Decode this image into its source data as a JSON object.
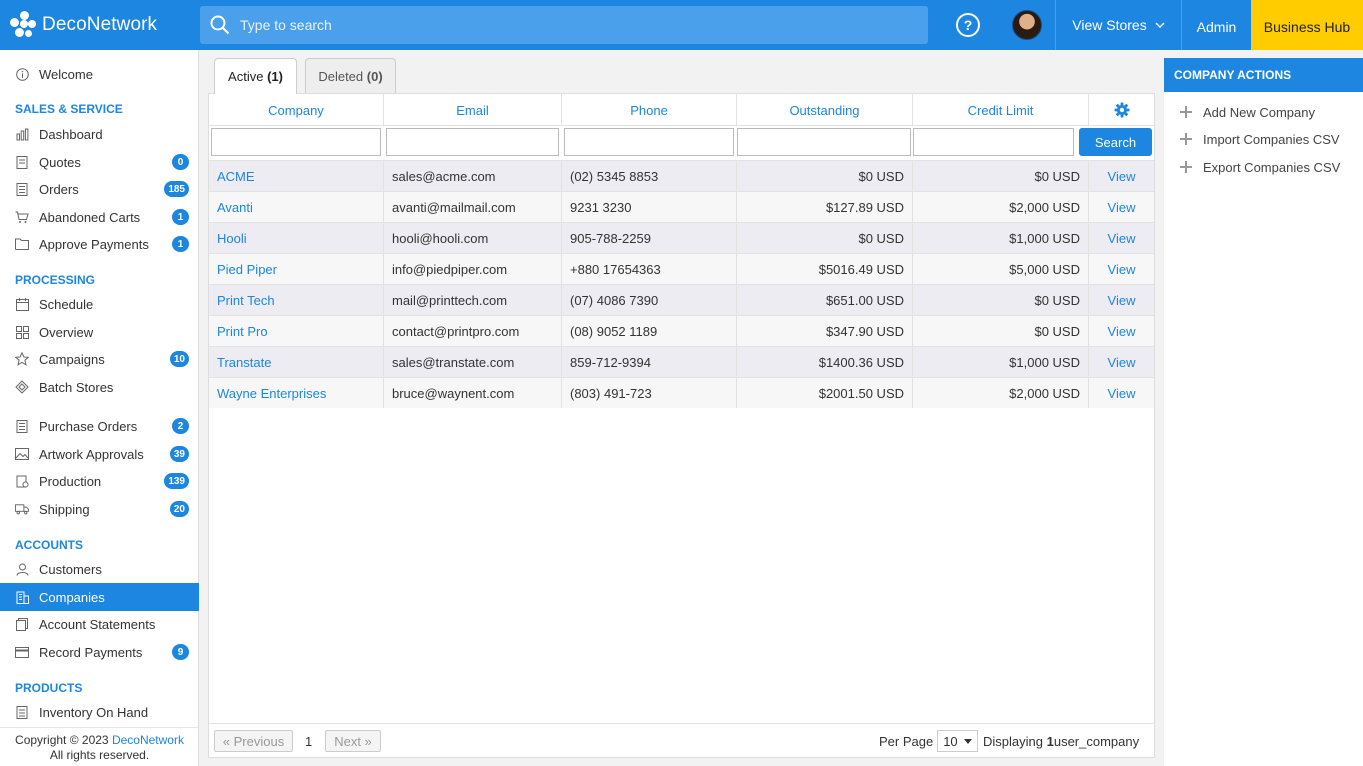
{
  "header": {
    "logo_text": "DecoNetwork",
    "search_placeholder": "Type to search",
    "help_label": "?",
    "view_stores_label": "View Stores",
    "admin_label": "Admin",
    "business_hub_label": "Business Hub"
  },
  "sidebar": {
    "welcome": "Welcome",
    "sections": {
      "sales": "SALES & SERVICE",
      "processing": "PROCESSING",
      "accounts": "ACCOUNTS",
      "products": "PRODUCTS"
    },
    "items": {
      "dashboard": "Dashboard",
      "quotes": "Quotes",
      "quotes_badge": "0",
      "orders": "Orders",
      "orders_badge": "185",
      "abandoned_carts": "Abandoned Carts",
      "abandoned_carts_badge": "1",
      "approve_payments": "Approve Payments",
      "approve_payments_badge": "1",
      "schedule": "Schedule",
      "overview": "Overview",
      "campaigns": "Campaigns",
      "campaigns_badge": "10",
      "batch_stores": "Batch Stores",
      "purchase_orders": "Purchase Orders",
      "purchase_orders_badge": "2",
      "artwork_approvals": "Artwork Approvals",
      "artwork_approvals_badge": "39",
      "production": "Production",
      "production_badge": "139",
      "shipping": "Shipping",
      "shipping_badge": "20",
      "customers": "Customers",
      "companies": "Companies",
      "account_statements": "Account Statements",
      "record_payments": "Record Payments",
      "record_payments_badge": "9",
      "inventory_on_hand": "Inventory On Hand"
    },
    "footer": {
      "copyright": "Copyright © 2023 ",
      "brand_link": "DecoNetwork",
      "rights": "All rights reserved."
    }
  },
  "tabs": {
    "active_label": "Active",
    "active_count": "(1)",
    "deleted_label": "Deleted",
    "deleted_count": "(0)"
  },
  "grid": {
    "columns": [
      "Company",
      "Email",
      "Phone",
      "Outstanding",
      "Credit Limit"
    ],
    "search_label": "Search",
    "view_label": "View",
    "rows": [
      [
        "ACME",
        "sales@acme.com",
        "(02) 5345 8853",
        "$0 USD",
        "$0 USD"
      ],
      [
        "Avanti",
        "avanti@mailmail.com",
        "9231 3230",
        "$127.89 USD",
        "$2,000 USD"
      ],
      [
        "Hooli",
        "hooli@hooli.com",
        "905-788-2259",
        "$0 USD",
        "$1,000 USD"
      ],
      [
        "Pied Piper",
        "info@piedpiper.com",
        "+880 17654363",
        "$5016.49 USD",
        "$5,000 USD"
      ],
      [
        "Print Tech",
        "mail@printtech.com",
        "(07) 4086 7390",
        "$651.00 USD",
        "$0 USD"
      ],
      [
        "Print Pro",
        "contact@printpro.com",
        "(08) 9052 1189",
        "$347.90 USD",
        "$0 USD"
      ],
      [
        "Transtate",
        "sales@transtate.com",
        "859-712-9394",
        "$1400.36 USD",
        "$1,000 USD"
      ],
      [
        "Wayne Enterprises",
        "bruce@waynent.com",
        "(803) 491-723",
        "$2001.50 USD",
        "$2,000 USD"
      ]
    ]
  },
  "pager": {
    "previous": "« Previous",
    "page": "1",
    "next": "Next »",
    "per_page_label": "Per Page",
    "per_page_value": "10",
    "displaying_prefix": "Displaying ",
    "displaying_count": "1",
    "displaying_suffix": " user_company"
  },
  "actions": {
    "title": "COMPANY ACTIONS",
    "add_new": "Add New Company",
    "import_csv": "Import Companies CSV",
    "export_csv": "Export Companies CSV"
  },
  "colors": {
    "accent": "#1c86e0",
    "business_hub": "#ffcc00"
  }
}
